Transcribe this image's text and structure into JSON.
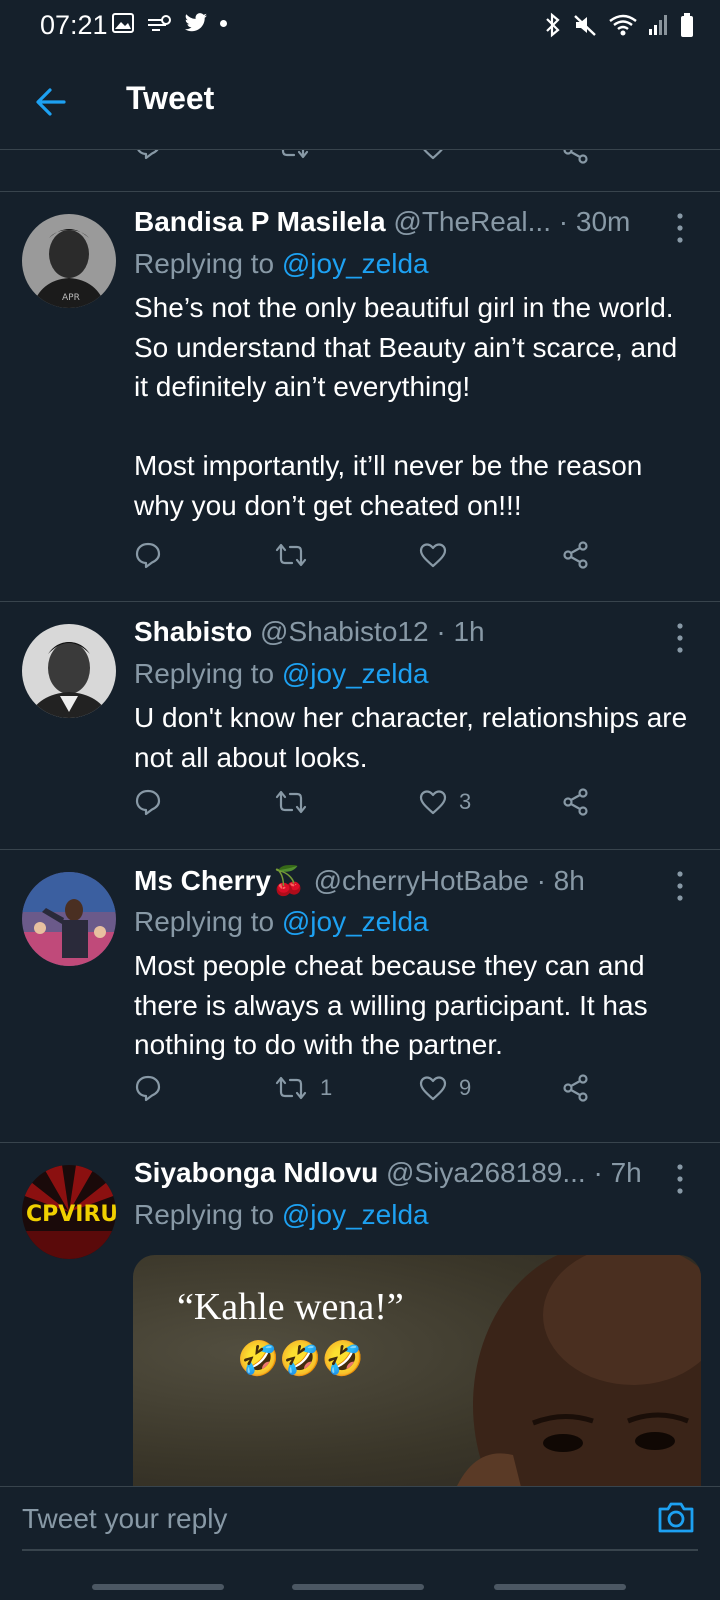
{
  "status_bar": {
    "time": "07:21"
  },
  "header": {
    "title": "Tweet"
  },
  "tweets": [
    {
      "name": "Bandisa P Masilela",
      "handle": "@TheReal...",
      "time": "· 30m",
      "replying_prefix": "Replying to ",
      "replying_to": "@joy_zelda",
      "text": "She’s not the only beautiful girl in the world. So understand that Beauty ain’t scarce, and it definitely ain’t everything!\n\nMost importantly, it’ll never be the reason why you don’t get cheated on!!!",
      "retweets": "",
      "likes": ""
    },
    {
      "name": "Shabisto",
      "handle": "@Shabisto12",
      "time": "· 1h",
      "replying_prefix": "Replying to ",
      "replying_to": "@joy_zelda",
      "text": "U don't know her character, relationships are not all about looks.",
      "retweets": "",
      "likes": "3"
    },
    {
      "name": "Ms Cherry",
      "name_emoji": "🍒",
      "handle": "@cherryHotBabe",
      "time": "· 8h",
      "replying_prefix": "Replying to ",
      "replying_to": "@joy_zelda",
      "text": "Most people cheat because they can and there is always a willing participant. It has nothing to do with the partner.",
      "retweets": "1",
      "likes": "9"
    },
    {
      "name": "Siyabonga Ndlovu",
      "handle": "@Siya268189...",
      "time": "· 7h",
      "replying_prefix": "Replying to ",
      "replying_to": "@joy_zelda",
      "avatar_text": "CPVIRU",
      "media_caption": "“Kahle wena!”",
      "media_emoji": "🤣🤣🤣"
    }
  ],
  "reply_bar": {
    "placeholder": "Tweet your reply"
  },
  "colors": {
    "background": "#15202b",
    "divider": "#38444d",
    "secondary_text": "#8899a6",
    "accent": "#1da1f2"
  },
  "icons": {
    "back": "arrow-left-icon",
    "reply": "comment-icon",
    "retweet": "retweet-icon",
    "like": "heart-icon",
    "share": "share-icon",
    "more": "vertical-dots-icon",
    "camera": "camera-icon"
  }
}
